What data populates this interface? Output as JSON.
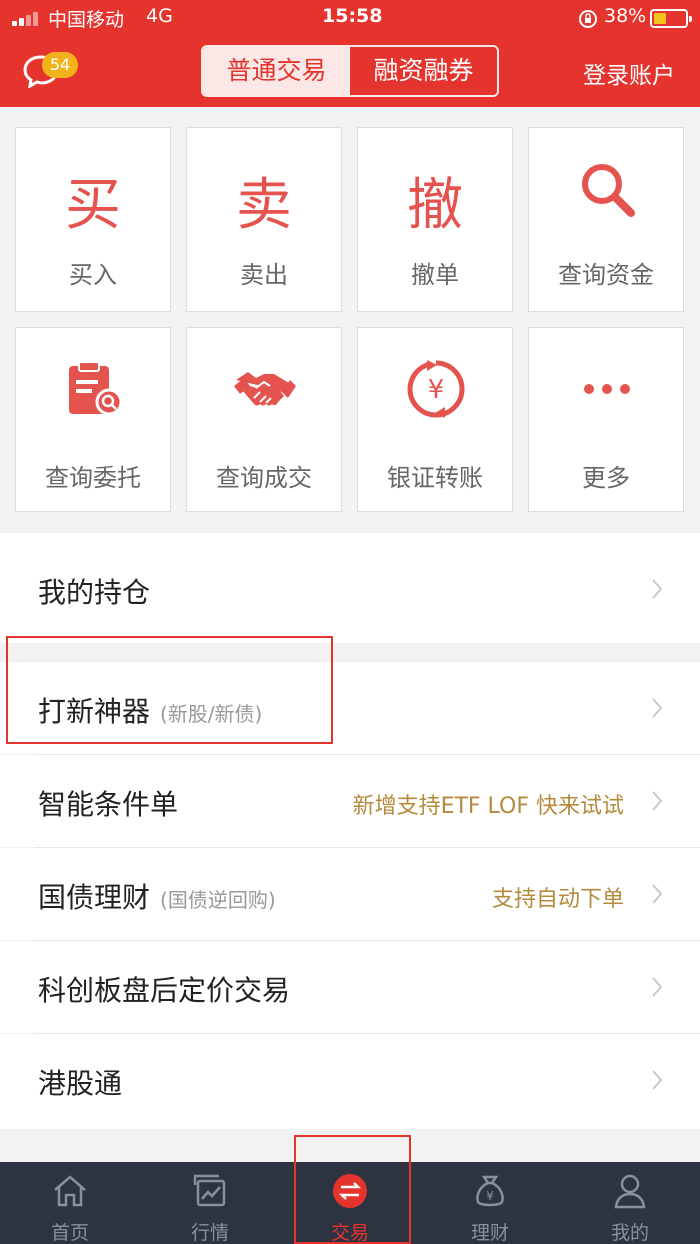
{
  "status_bar": {
    "carrier": "中国移动",
    "network": "4G",
    "time": "15:58",
    "battery": "38%"
  },
  "header": {
    "message_count": "54",
    "tabs": [
      {
        "label": "普通交易",
        "active": true
      },
      {
        "label": "融资融券",
        "active": false
      }
    ],
    "login_label": "登录账户"
  },
  "quick_actions": [
    {
      "glyph": "买",
      "label": "买入"
    },
    {
      "glyph": "卖",
      "label": "卖出"
    },
    {
      "glyph": "撤",
      "label": "撤单"
    },
    {
      "icon": "search-icon",
      "label": "查询资金"
    },
    {
      "icon": "clipboard-icon",
      "label": "查询委托"
    },
    {
      "icon": "handshake-icon",
      "label": "查询成交"
    },
    {
      "icon": "yen-transfer-icon",
      "label": "银证转账"
    },
    {
      "icon": "more-dots-icon",
      "label": "更多"
    }
  ],
  "menu": {
    "holdings": {
      "title": "我的持仓"
    },
    "ipo": {
      "title": "打新神器",
      "sub": "(新股/新债)"
    },
    "condition": {
      "title": "智能条件单",
      "note": "新增支持ETF LOF 快来试试"
    },
    "bond": {
      "title": "国债理财",
      "sub": "(国债逆回购)",
      "note": "支持自动下单"
    },
    "star": {
      "title": "科创板盘后定价交易"
    },
    "hk": {
      "title": "港股通"
    }
  },
  "tabbar": [
    {
      "icon": "home-icon",
      "label": "首页"
    },
    {
      "icon": "market-icon",
      "label": "行情"
    },
    {
      "icon": "trade-icon",
      "label": "交易",
      "active": true
    },
    {
      "icon": "wealth-icon",
      "label": "理财"
    },
    {
      "icon": "profile-icon",
      "label": "我的"
    }
  ],
  "colors": {
    "brand": "#e5342e",
    "icon_red": "#e5534f",
    "note_gold": "#b48a3c",
    "tabbar_bg": "#2e3342"
  }
}
